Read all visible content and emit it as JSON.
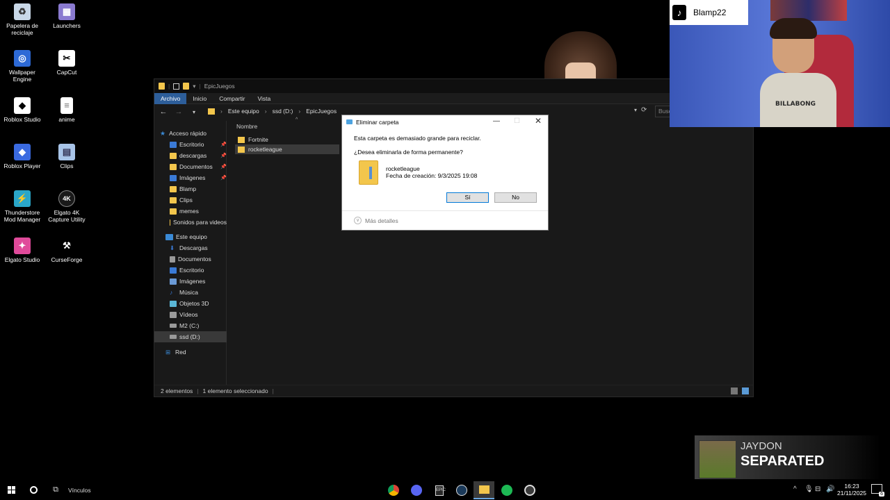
{
  "desktop": {
    "icons": [
      {
        "label": "Papelera de reciclaje",
        "icon": "recycle-bin-icon",
        "color": "#c9d8e8"
      },
      {
        "label": "Launchers",
        "icon": "folder-launchers-icon",
        "color": "#8a7ad0"
      },
      {
        "label": "Wallpaper Engine",
        "icon": "wallpaper-engine-icon",
        "color": "#2d6ad6"
      },
      {
        "label": "CapCut",
        "icon": "capcut-icon",
        "color": "#ffffff"
      },
      {
        "label": "Roblox Studio",
        "icon": "roblox-studio-icon",
        "color": "#ffffff"
      },
      {
        "label": "anime",
        "icon": "document-icon",
        "color": "#ffffff"
      },
      {
        "label": "Roblox Player",
        "icon": "roblox-player-icon",
        "color": "#3a6ae0"
      },
      {
        "label": "Clips",
        "icon": "folder-clips-icon",
        "color": "#a8c4e8"
      },
      {
        "label": "Thunderstore Mod Manager",
        "icon": "thunderstore-icon",
        "color": "#2aa6c8"
      },
      {
        "label": "Elgato 4K Capture Utility",
        "icon": "elgato-4k-icon",
        "color": "#1a1a1a"
      },
      {
        "label": "Elgato Studio",
        "icon": "elgato-studio-icon",
        "color": "#e04a9a"
      },
      {
        "label": "CurseForge",
        "icon": "curseforge-icon",
        "color": "#ffffff"
      }
    ]
  },
  "explorer": {
    "title": "EpicJuegos",
    "ribbon_tabs": [
      "Archivo",
      "Inicio",
      "Compartir",
      "Vista"
    ],
    "breadcrumb": [
      "Este equipo",
      "ssd (D:)",
      "EpicJuegos"
    ],
    "search_placeholder": "Busc",
    "nav": {
      "quick_access": "Acceso rápido",
      "quick_items": [
        {
          "label": "Escritorio",
          "pinned": true,
          "color": "#3a7ad6"
        },
        {
          "label": "descargas",
          "pinned": true,
          "color": "#f3c64c"
        },
        {
          "label": "Documentos",
          "pinned": true,
          "color": "#f3c64c"
        },
        {
          "label": "Imágenes",
          "pinned": true,
          "color": "#3a7ad6"
        },
        {
          "label": "Blamp",
          "pinned": false,
          "color": "#f3c64c"
        },
        {
          "label": "Clips",
          "pinned": false,
          "color": "#f3c64c"
        },
        {
          "label": "memes",
          "pinned": false,
          "color": "#f3c64c"
        },
        {
          "label": "Sonidos para videos",
          "pinned": false,
          "color": "#f3c64c"
        }
      ],
      "this_pc": "Este equipo",
      "pc_items": [
        {
          "label": "Descargas",
          "color": "#3a7ad6"
        },
        {
          "label": "Documentos",
          "color": "#9a9a9a"
        },
        {
          "label": "Escritorio",
          "color": "#3a7ad6"
        },
        {
          "label": "Imágenes",
          "color": "#6a9ad6"
        },
        {
          "label": "Música",
          "color": "#3a7ad6"
        },
        {
          "label": "Objetos 3D",
          "color": "#5ab6d6"
        },
        {
          "label": "Vídeos",
          "color": "#9a9a9a"
        },
        {
          "label": "M2 (C:)",
          "color": "#9a9a9a"
        },
        {
          "label": "ssd (D:)",
          "color": "#9a9a9a"
        }
      ],
      "network": "Red"
    },
    "column_name": "Nombre",
    "files": [
      "Fortnite",
      "rocketleague"
    ],
    "selected_file": "rocketleague",
    "status": {
      "count": "2 elementos",
      "selected": "1 elemento seleccionado"
    }
  },
  "dialog": {
    "title": "Eliminar carpeta",
    "line1": "Esta carpeta es demasiado grande para reciclar.",
    "line2": "¿Desea eliminarla de forma permanente?",
    "folder_name": "rocketleague",
    "folder_date": "Fecha de creación: 9/3/2025 19:08",
    "yes_label": "Sí",
    "no_label": "No",
    "details_label": "Más detalles"
  },
  "webcam": {
    "username": "Blamp22",
    "shirt_text": "BILLABONG"
  },
  "now_playing": {
    "artist": "JAYDON",
    "title": "SEPARATED"
  },
  "taskbar": {
    "search_text": "Vínculos",
    "apps": [
      {
        "name": "chrome-icon",
        "color": "#e0a030"
      },
      {
        "name": "discord-icon",
        "color": "#5865f2"
      },
      {
        "name": "epic-games-icon",
        "color": "#2a2a2a"
      },
      {
        "name": "steam-icon",
        "color": "#1b3a5a"
      },
      {
        "name": "file-explorer-icon",
        "color": "#f3c64c"
      },
      {
        "name": "spotify-icon",
        "color": "#1db954"
      },
      {
        "name": "obs-icon",
        "color": "#3a3a3a"
      }
    ],
    "time": "16:23",
    "date": "21/11/2025",
    "notification_count": "6"
  }
}
